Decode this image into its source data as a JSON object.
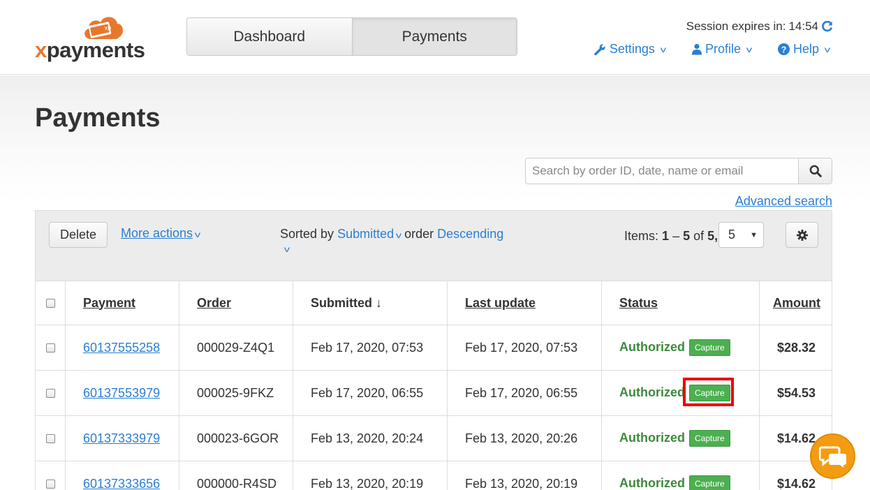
{
  "brand": {
    "logo_prefix": "x",
    "logo_rest": "payments",
    "logo_badge": "xp"
  },
  "nav": {
    "tabs": [
      {
        "label": "Dashboard"
      },
      {
        "label": "Payments"
      }
    ]
  },
  "session": {
    "label": "Session expires in:",
    "time": "14:54"
  },
  "top_menu": {
    "settings": "Settings",
    "profile": "Profile",
    "help": "Help"
  },
  "page": {
    "title": "Payments"
  },
  "search": {
    "placeholder": "Search by order ID, date, name or email",
    "advanced_label": "Advanced search"
  },
  "toolbar": {
    "delete_label": "Delete",
    "more_actions_label": "More actions",
    "sorted_by_prefix": "Sorted by",
    "sorted_by_value": "Submitted",
    "order_prefix": "order",
    "order_value": "Descending",
    "items_prefix": "Items:",
    "items_from": "1",
    "items_dash": "–",
    "items_to": "5",
    "items_of": "of",
    "items_total": "5,",
    "per_page": "5"
  },
  "table": {
    "columns": [
      "Payment",
      "Order",
      "Submitted ↓",
      "Last update",
      "Status",
      "Amount"
    ],
    "rows": [
      {
        "payment": "60137555258",
        "order": "000029-Z4Q1",
        "submitted": "Feb 17, 2020, 07:53",
        "updated": "Feb 17, 2020, 07:53",
        "status": "Authorized",
        "action": "Capture",
        "amount": "$28.32"
      },
      {
        "payment": "60137553979",
        "order": "000025-9FKZ",
        "submitted": "Feb 17, 2020, 06:55",
        "updated": "Feb 17, 2020, 06:55",
        "status": "Authorized",
        "action": "Capture",
        "amount": "$54.53"
      },
      {
        "payment": "60137333979",
        "order": "000023-6GOR",
        "submitted": "Feb 13, 2020, 20:24",
        "updated": "Feb 13, 2020, 20:26",
        "status": "Authorized",
        "action": "Capture",
        "amount": "$14.62"
      },
      {
        "payment": "60137333656",
        "order": "000000-R4SD",
        "submitted": "Feb 13, 2020, 20:19",
        "updated": "Feb 13, 2020, 20:19",
        "status": "Authorized",
        "action": "Capture",
        "amount": "$14.62"
      }
    ]
  },
  "colors": {
    "accent": "#2a7fd4",
    "status_green": "#3c8a3c",
    "capture_green": "#4caf50",
    "highlight": "#e00000",
    "brand_orange": "#e8772e"
  }
}
